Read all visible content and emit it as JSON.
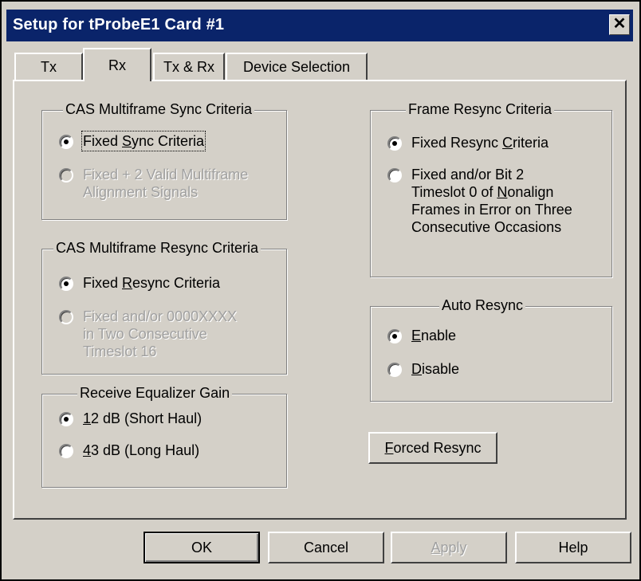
{
  "window": {
    "title": "Setup for tProbeE1 Card #1",
    "close_glyph": "✕"
  },
  "tabs": [
    {
      "label": "Tx",
      "active": false
    },
    {
      "label": "Rx",
      "active": true
    },
    {
      "label": "Tx & Rx",
      "active": false
    },
    {
      "label": "Device Selection",
      "active": false
    }
  ],
  "cas_sync": {
    "title": "CAS Multiframe Sync Criteria",
    "options": [
      {
        "label": "Fixed Sync Criteria",
        "checked": true,
        "enabled": true
      },
      {
        "label_line1": "Fixed + 2 Valid Multiframe",
        "label_line2": "Alignment Signals",
        "checked": false,
        "enabled": false
      }
    ]
  },
  "cas_resync": {
    "title": "CAS Multiframe Resync Criteria",
    "options": [
      {
        "label": "Fixed Resync Criteria",
        "checked": true,
        "enabled": true
      },
      {
        "label_line1": "Fixed and/or 0000XXXX",
        "label_line2": "in Two Consecutive",
        "label_line3": "Timeslot 16",
        "checked": false,
        "enabled": false
      }
    ]
  },
  "eq_gain": {
    "title": "Receive Equalizer Gain",
    "options": [
      {
        "label": "12 dB (Short Haul)",
        "checked": true
      },
      {
        "label": "43 dB (Long Haul)",
        "checked": false
      }
    ]
  },
  "frame_resync": {
    "title": "Frame Resync Criteria",
    "options": [
      {
        "label": "Fixed Resync Criteria",
        "checked": true
      },
      {
        "label_line1": "Fixed and/or Bit 2",
        "label_line2": "Timeslot 0 of Nonalign",
        "label_line3": "Frames in Error on Three",
        "label_line4": "Consecutive Occasions",
        "checked": false
      }
    ]
  },
  "auto_resync": {
    "title": "Auto Resync",
    "options": [
      {
        "label": "Enable",
        "checked": true
      },
      {
        "label": "Disable",
        "checked": false
      }
    ]
  },
  "forced_resync_button": "Forced Resync",
  "footer": {
    "ok": "OK",
    "cancel": "Cancel",
    "apply": "Apply",
    "help": "Help"
  }
}
